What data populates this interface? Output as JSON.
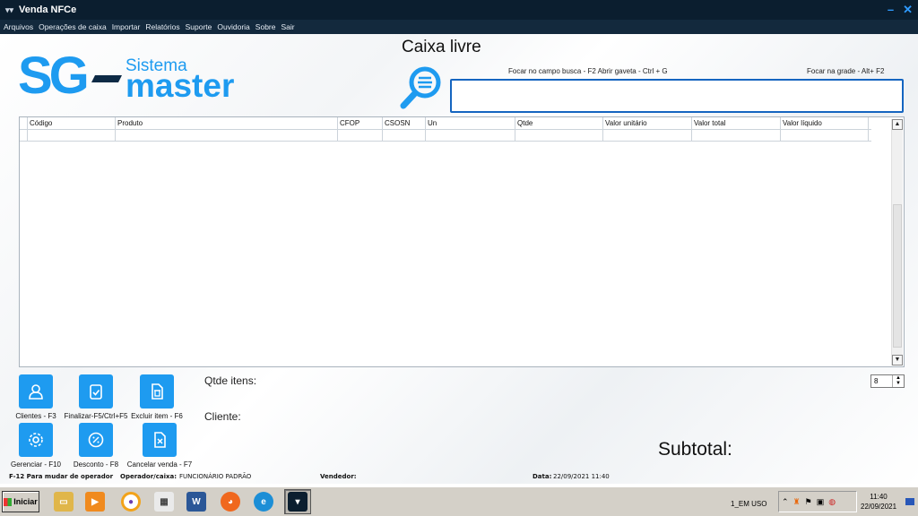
{
  "window": {
    "title": "Venda NFCe",
    "minimize_glyph": "–",
    "close_glyph": "✕"
  },
  "menu": [
    "Arquivos",
    "Operações de caixa",
    "Importar",
    "Relatórios",
    "Suporte",
    "Ouvidoria",
    "Sobre",
    "Sair"
  ],
  "logo": {
    "sg": "SG",
    "sistema": "Sistema",
    "master": "master"
  },
  "caixa_status": "Caixa livre",
  "hints": {
    "busca_gaveta": "Focar no campo busca - F2  Abrir gaveta - Ctrl + G",
    "grade": "Focar na grade  - Alt+ F2"
  },
  "search": {
    "value": ""
  },
  "grid": {
    "columns": [
      "",
      "Código",
      "Produto",
      "CFOP",
      "CSOSN",
      "Un",
      "Qtde",
      "Valor unitário",
      "Valor total",
      "Valor líquido"
    ],
    "rows": [
      [
        "",
        "",
        "",
        "",
        "",
        "",
        "",
        "",
        "",
        ""
      ]
    ]
  },
  "actions": {
    "clientes": "Clientes - F3",
    "finalizar": "Finalizar-F5/Ctrl+F5",
    "excluir": "Excluir item - F6",
    "gerenciar": "Gerenciar - F10",
    "desconto": "Desconto - F8",
    "cancelar": "Cancelar venda - F7"
  },
  "labels": {
    "qtde_itens": "Qtde itens:",
    "cliente": "Cliente:",
    "subtotal": "Subtotal:"
  },
  "qtde_spinner": {
    "value": "8"
  },
  "status": {
    "f12": "F-12 Para mudar de operador",
    "operador_label": "Operador/caixa:",
    "operador_value": "FUNCIONÁRIO PADRÃO",
    "vendedor_label": "Vendedor:",
    "data_label": "Data:",
    "data_value": "22/09/2021 11:40"
  },
  "taskbar": {
    "start": "Iniciar",
    "language": "1_EM USO",
    "time": "11:40",
    "date": "22/09/2021"
  },
  "colors": {
    "brand_blue": "#1e9bf0",
    "title_bar": "#0b1e2f",
    "menu_bar": "#13293d",
    "logo_dark": "#0d2a45"
  }
}
